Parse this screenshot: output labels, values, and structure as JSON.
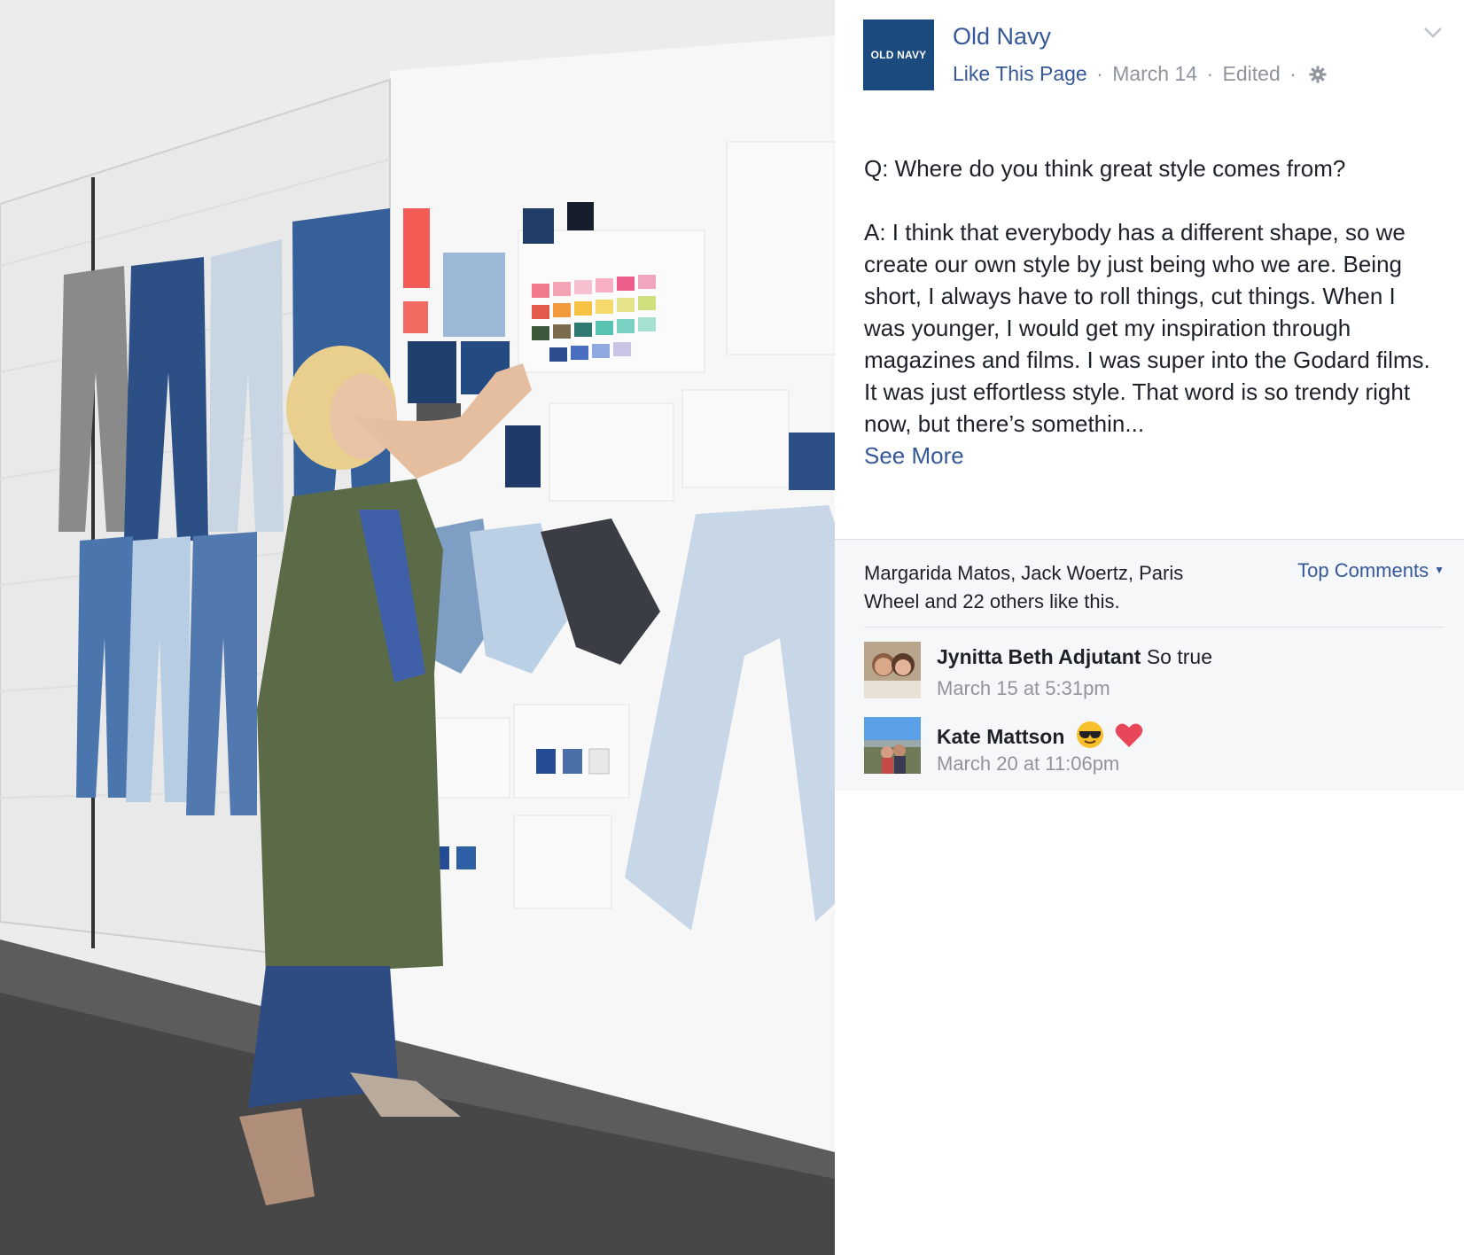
{
  "post": {
    "page": {
      "name": "Old Navy",
      "logo_text": "OLD NAVY"
    },
    "meta": {
      "like_page": "Like This Page",
      "date": "March 14",
      "edited": "Edited",
      "separator": "·"
    },
    "text": {
      "question": "Q: Where do you think great style comes from?",
      "answer": "A: I think that everybody has a different shape, so we create our own style by just being who we are. Being short, I always have to roll things, cut things. When I was younger, I would get my inspiration through magazines and films. I was super into the Godard films. It was just effortless style. That word is so trendy right now, but there’s somethin...",
      "see_more": "See More"
    },
    "icons": {
      "menu": "chevron-down-icon",
      "audience": "gear-icon"
    }
  },
  "ufi": {
    "likes_summary": "Margarida Matos, Jack Woertz, Paris Wheel and 22 others like this.",
    "sort_label": "Top Comments",
    "comments": [
      {
        "author": "Jynitta Beth Adjutant",
        "text": "So true",
        "time": "March 15 at 5:31pm"
      },
      {
        "author": "Kate Mattson",
        "text": "",
        "emojis": [
          "sunglasses-emoji",
          "red-heart-emoji"
        ],
        "time": "March 20 at 11:06pm"
      }
    ]
  },
  "colors": {
    "link": "#365899",
    "meta_gray": "#90949c",
    "text": "#1d2129",
    "ufi_background": "#f6f7f9",
    "logo_background": "#1b4a7e"
  }
}
